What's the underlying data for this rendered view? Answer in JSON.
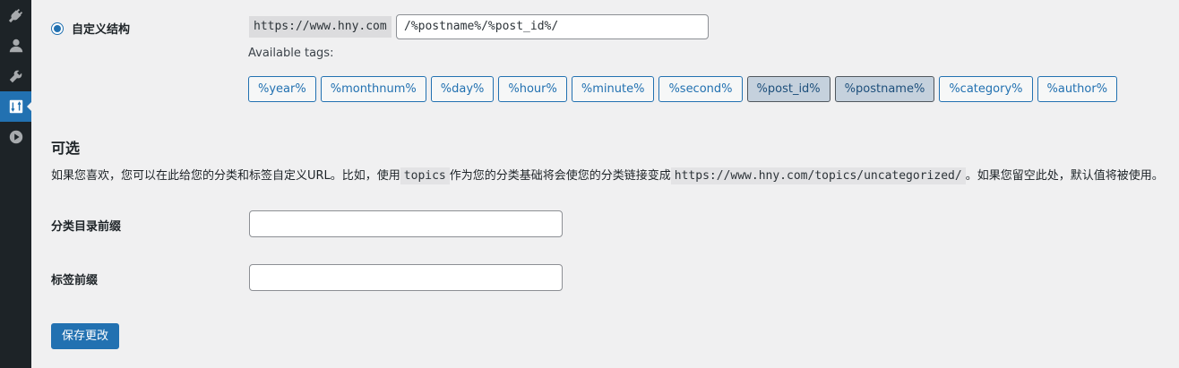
{
  "sidebar": {
    "icons": [
      "plugins-icon",
      "users-icon",
      "tools-icon",
      "settings-icon",
      "media-play-icon"
    ],
    "active_index": 3,
    "active_color": "#2271b1"
  },
  "custom_structure": {
    "label": "自定义结构",
    "selected": true,
    "prefix": "https://www.hny.com",
    "value": "/%postname%/%post_id%/",
    "available_tags_label": "Available tags:",
    "tags": [
      {
        "label": "%year%",
        "active": false
      },
      {
        "label": "%monthnum%",
        "active": false
      },
      {
        "label": "%day%",
        "active": false
      },
      {
        "label": "%hour%",
        "active": false
      },
      {
        "label": "%minute%",
        "active": false
      },
      {
        "label": "%second%",
        "active": false
      },
      {
        "label": "%post_id%",
        "active": true
      },
      {
        "label": "%postname%",
        "active": true
      },
      {
        "label": "%category%",
        "active": false
      },
      {
        "label": "%author%",
        "active": false
      }
    ]
  },
  "optional": {
    "title": "可选",
    "desc_part1": "如果您喜欢，您可以在此给您的分类和标签自定义URL。比如，使用",
    "desc_code1": "topics",
    "desc_part2": "作为您的分类基础将会使您的分类链接变成",
    "desc_code2": "https://www.hny.com/topics/uncategorized/",
    "desc_part3": "。如果您留空此处，默认值将被使用。",
    "category_base_label": "分类目录前缀",
    "category_base_value": "",
    "tag_base_label": "标签前缀",
    "tag_base_value": ""
  },
  "save_button": "保存更改"
}
